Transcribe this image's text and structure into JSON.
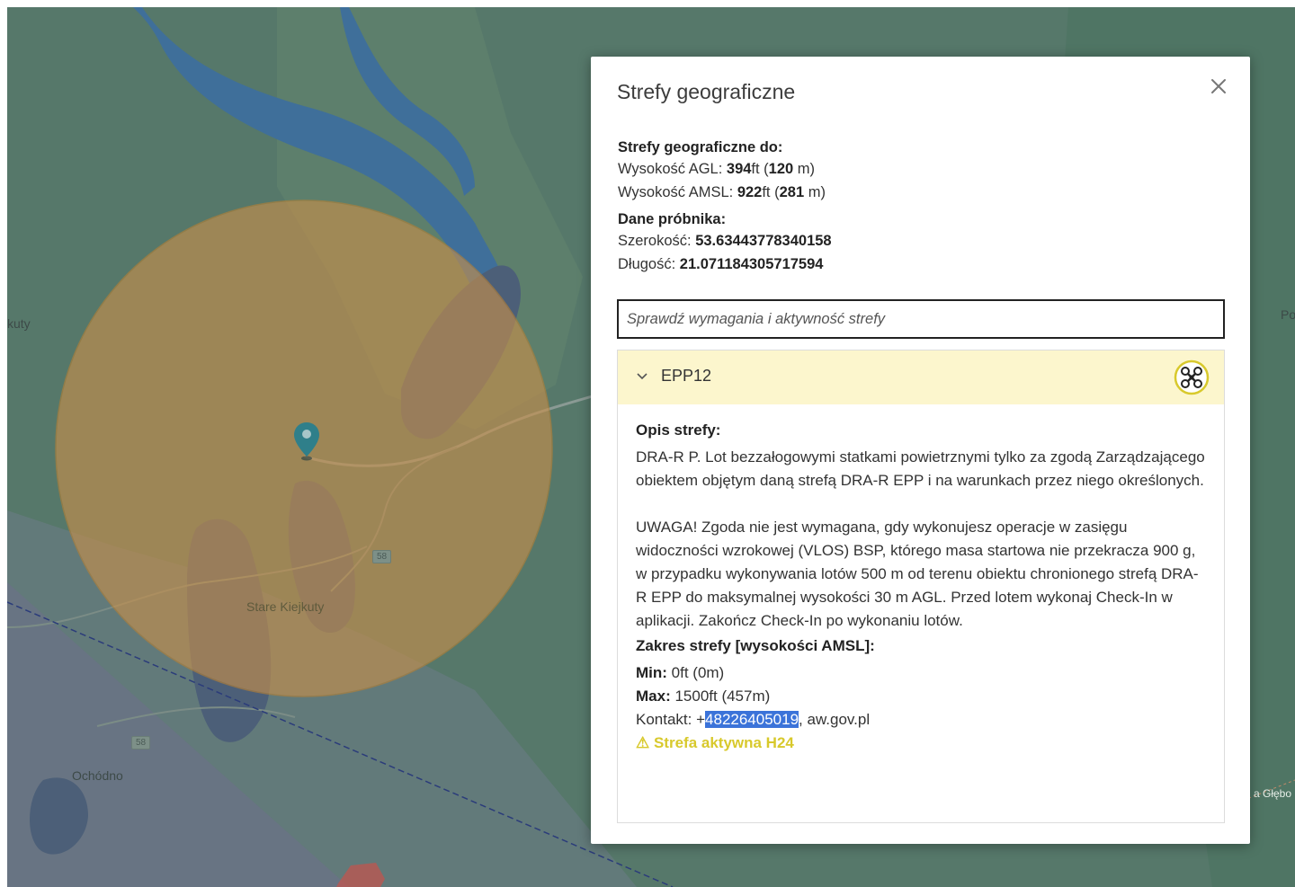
{
  "map": {
    "labels": {
      "town": "Stare Kiejkuty",
      "village": "Ochódno",
      "west": "kuty",
      "east_top": "Po",
      "east_bottom": "a Głębo"
    },
    "road_numbers": [
      "58",
      "58"
    ],
    "colors": {
      "zone_fill": "#c9904a",
      "water": "#3f6f9a",
      "forest": "#56786a"
    }
  },
  "dialog": {
    "title": "Strefy geograficzne",
    "close_icon": "close-icon",
    "zones_to": {
      "heading": "Strefy geograficzne do:",
      "agl_label": "Wysokość AGL: ",
      "agl_ft": "394",
      "agl_ft_unit": "ft (",
      "agl_m": "120",
      "agl_m_unit": " m)",
      "amsl_label": "Wysokość AMSL: ",
      "amsl_ft": "922",
      "amsl_ft_unit": "ft (",
      "amsl_m": "281",
      "amsl_m_unit": " m)"
    },
    "sampler": {
      "heading": "Dane próbnika:",
      "lat_label": "Szerokość: ",
      "lat": "53.63443778340158",
      "lon_label": "Długość: ",
      "lon": "21.071184305717594"
    },
    "search": {
      "placeholder": "Sprawdź wymagania i aktywność strefy",
      "value": ""
    },
    "zone": {
      "name": "EPP12",
      "icon": "drone-icon",
      "desc_heading": "Opis strefy:",
      "desc_1": "DRA-R P. Lot bezzałogowymi statkami powietrznymi tylko za zgodą Zarządzającego obiektem objętym daną strefą DRA-R EPP i na warunkach przez niego określonych.",
      "desc_2": "UWAGA! Zgoda nie jest wymagana, gdy wykonujesz operacje w zasięgu widoczności wzrokowej (VLOS) BSP, którego masa startowa nie przekracza 900 g, w przypadku wykonywania lotów 500 m od terenu obiektu chronionego strefą DRA-R EPP do maksymalnej wysokości 30 m AGL. Przed lotem wykonaj Check-In w aplikacji. Zakończ Check-In po wykonaniu lotów.",
      "range_heading": "Zakres strefy [wysokości AMSL]:",
      "min_label": "Min:",
      "min_value": " 0ft (0m)",
      "max_label": "Max:",
      "max_value": " 1500ft (457m)",
      "contact_label": "Kontakt: +",
      "contact_phone": "48226405019",
      "contact_rest": ", aw.gov.pl",
      "status": "⚠ Strefa aktywna H24",
      "status_color": "#d8c92c",
      "header_bg": "#fcf6cd"
    }
  }
}
